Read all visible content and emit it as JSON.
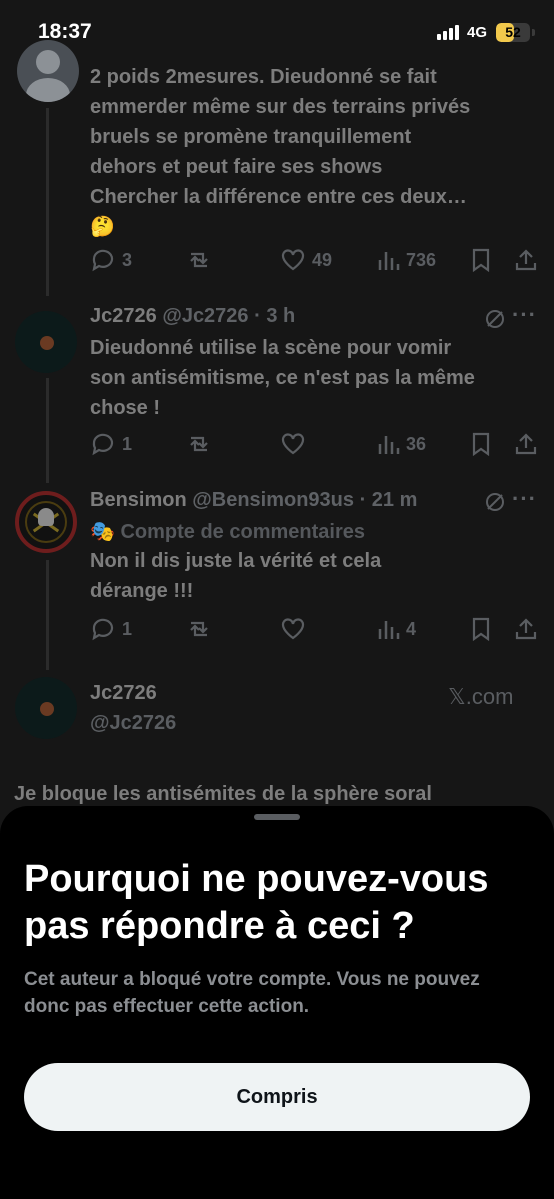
{
  "status_bar": {
    "time": "18:37",
    "network": "4G",
    "battery": "52",
    "battery_level": 0.52
  },
  "tweets": [
    {
      "text": "2 poids  2mesures. Dieudonné se fait\nemmerder même sur des terrains privés\nbruels se promène tranquillement\ndehors et peut faire ses  shows\nChercher la différence entre ces deux…\n🤔",
      "replies": "3",
      "retweets": "",
      "likes": "49",
      "views": "736"
    },
    {
      "name": "Jc2726",
      "handle": "@Jc2726",
      "time": "· 3 h",
      "text": "Dieudonné utilise la scène pour vomir\nson antisémitisme, ce n'est pas la même\nchose !",
      "replies": "1",
      "retweets": "",
      "likes": "",
      "views": "36"
    },
    {
      "name": "Bensimon",
      "handle": "@Bensimon93us",
      "time": "· 21 m",
      "community": "🎭 Compte de commentaires",
      "text": "Non il dis juste la vérité et cela\ndérange !!!",
      "replies": "1",
      "retweets": "",
      "likes": "",
      "views": "4"
    }
  ],
  "embed": {
    "name": "Jc2726",
    "handle": "@Jc2726",
    "source": "𝕏.com",
    "text": "Je bloque les antisémites de la sphère soral"
  },
  "sheet": {
    "title": "Pourquoi ne pouvez-vous pas répondre à ceci ?",
    "description": "Cet auteur a bloqué votre compte. Vous ne pouvez donc pas effectuer cette action.",
    "button": "Compris"
  },
  "colors": {
    "battery": "#f2c94c",
    "sheet_bg": "#000000",
    "button_bg": "#eff3f4"
  }
}
